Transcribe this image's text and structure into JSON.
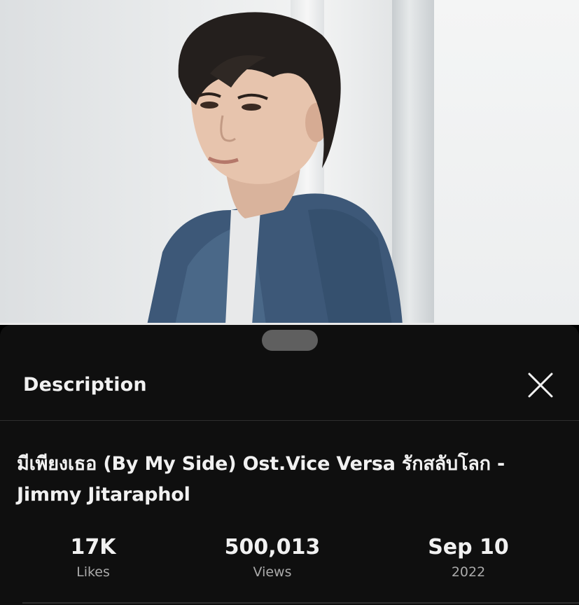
{
  "sheet": {
    "title": "Description",
    "close_icon": "close-icon"
  },
  "video": {
    "title": "มีเพียงเธอ (By My Side) Ost.Vice Versa รักสลับโลก - Jimmy Jitaraphol"
  },
  "stats": [
    {
      "value": "17K",
      "label": "Likes"
    },
    {
      "value": "500,013",
      "label": "Views"
    },
    {
      "value": "Sep 10",
      "label": "2022"
    }
  ],
  "colors": {
    "sheet_bg": "#0f0f0f",
    "text_primary": "#f1f1f1",
    "text_secondary": "#aaaaaa",
    "handle": "#5f5f5f"
  }
}
